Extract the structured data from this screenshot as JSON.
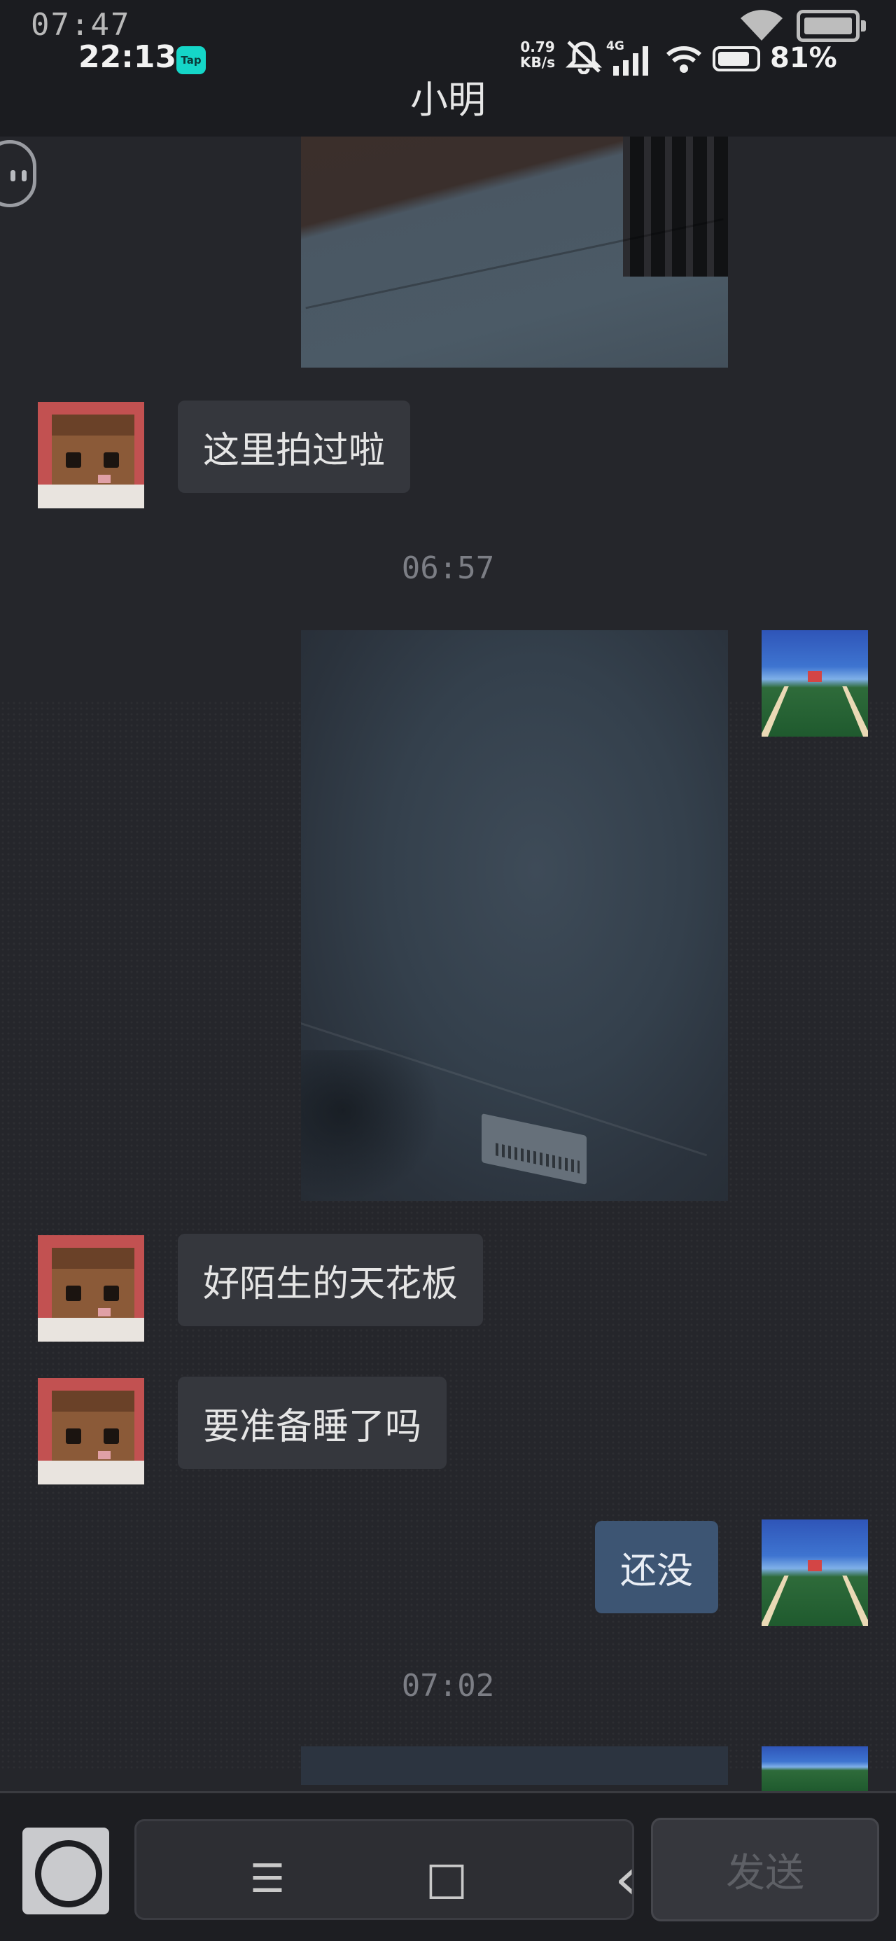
{
  "status_bar": {
    "overlay_time": "07:47",
    "clock": "22:13",
    "tap_badge": "Tap",
    "net_speed_value": "0.79",
    "net_speed_unit": "KB/s",
    "network_type": "4G",
    "battery_percent": "81%",
    "icons": [
      "mute-bell-icon",
      "signal-icon",
      "wifi-icon",
      "battery-icon"
    ]
  },
  "header": {
    "title": "小明"
  },
  "messages": {
    "m1": {
      "sender": "friend",
      "text": "这里拍过啦"
    },
    "ts1": "06:57",
    "m2": {
      "sender": "friend",
      "text": "好陌生的天花板"
    },
    "m3": {
      "sender": "friend",
      "text": "要准备睡了吗"
    },
    "m4": {
      "sender": "me",
      "text": "还没"
    },
    "ts2": "07:02"
  },
  "composer": {
    "send_label": "发送"
  },
  "nav_bar": {
    "menu_key": "☰",
    "home_key": "□",
    "back_key": "‹"
  },
  "colors": {
    "background": "#25262b",
    "friend_bubble": "#35373d",
    "my_bubble": "#3d5573",
    "tap_badge": "#15d6c8"
  }
}
